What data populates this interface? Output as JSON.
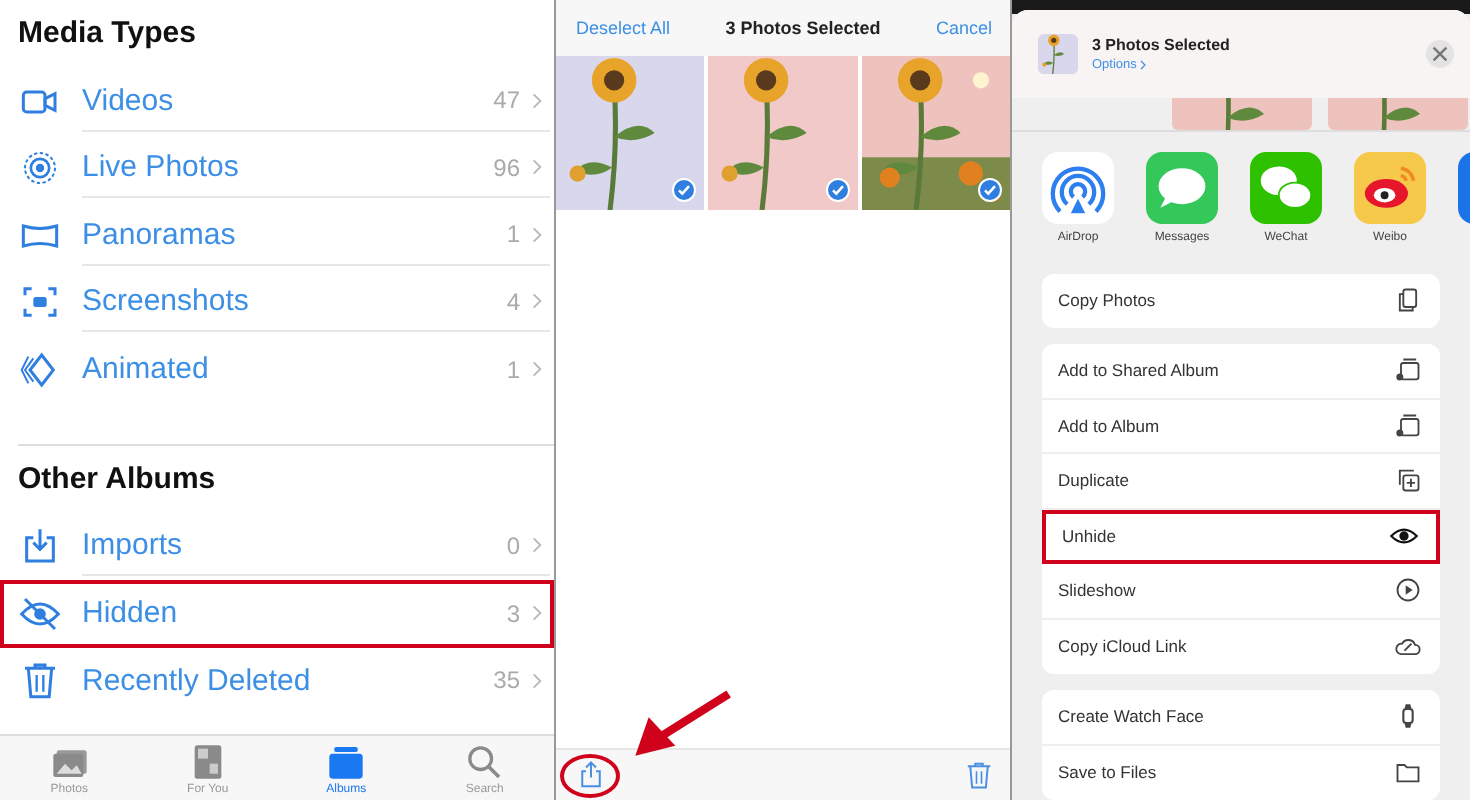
{
  "albums_panel": {
    "sections": [
      {
        "title": "Media Types",
        "items": [
          {
            "label": "Videos",
            "count": "47",
            "kind": "video",
            "highlighted": false
          },
          {
            "label": "Live Photos",
            "count": "96",
            "kind": "live",
            "highlighted": false
          },
          {
            "label": "Panoramas",
            "count": "1",
            "kind": "panorama",
            "highlighted": false
          },
          {
            "label": "Screenshots",
            "count": "4",
            "kind": "screenshot",
            "highlighted": false
          },
          {
            "label": "Animated",
            "count": "1",
            "kind": "animated",
            "highlighted": false
          }
        ]
      },
      {
        "title": "Other Albums",
        "items": [
          {
            "label": "Imports",
            "count": "0",
            "kind": "import",
            "highlighted": false
          },
          {
            "label": "Hidden",
            "count": "3",
            "kind": "hidden",
            "highlighted": true
          },
          {
            "label": "Recently Deleted",
            "count": "35",
            "kind": "trash",
            "highlighted": false
          }
        ]
      }
    ],
    "tab_bar": [
      {
        "label": "Photos",
        "kind": "photos",
        "selected": false
      },
      {
        "label": "For You",
        "kind": "foryou",
        "selected": false
      },
      {
        "label": "Albums",
        "kind": "albums",
        "selected": true
      },
      {
        "label": "Search",
        "kind": "search",
        "selected": false
      }
    ]
  },
  "selection_panel": {
    "deselect": "Deselect All",
    "title": "3 Photos Selected",
    "cancel": "Cancel",
    "photos": [
      {
        "kind": "picture",
        "checked": true
      },
      {
        "kind": "picture",
        "checked": true
      },
      {
        "kind": "picture",
        "checked": true
      }
    ],
    "toolbar": {
      "share_highlighted": true,
      "arrow": true
    }
  },
  "share_sheet": {
    "title": "3 Photos Selected",
    "options": "Options",
    "apps": [
      {
        "label": "AirDrop",
        "kind": "airdrop"
      },
      {
        "label": "Messages",
        "kind": "messages"
      },
      {
        "label": "WeChat",
        "kind": "wechat"
      },
      {
        "label": "Weibo",
        "kind": "weibo"
      }
    ],
    "groups": [
      [
        {
          "label": "Copy Photos",
          "kind": "copy",
          "highlighted": false
        }
      ],
      [
        {
          "label": "Add to Shared Album",
          "kind": "shared",
          "highlighted": false
        },
        {
          "label": "Add to Album",
          "kind": "album",
          "highlighted": false
        },
        {
          "label": "Duplicate",
          "kind": "duplicate",
          "highlighted": false
        },
        {
          "label": "Unhide",
          "kind": "eye",
          "highlighted": true
        },
        {
          "label": "Slideshow",
          "kind": "play",
          "highlighted": false
        },
        {
          "label": "Copy iCloud Link",
          "kind": "link",
          "highlighted": false
        }
      ],
      [
        {
          "label": "Create Watch Face",
          "kind": "watch",
          "highlighted": false
        },
        {
          "label": "Save to Files",
          "kind": "folder",
          "highlighted": false
        }
      ]
    ]
  }
}
